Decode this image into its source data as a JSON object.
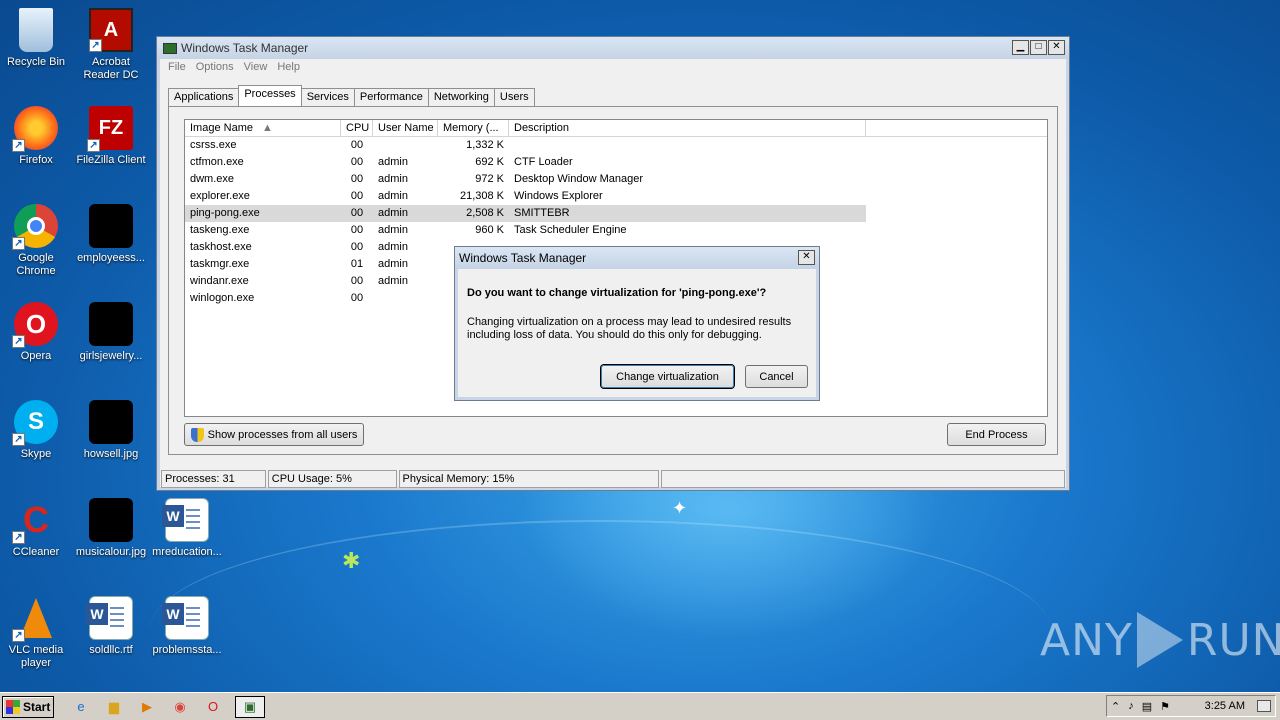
{
  "desktop": {
    "icons": [
      {
        "label": "Recycle Bin"
      },
      {
        "label": "Acrobat Reader DC"
      },
      {
        "label": "Firefox"
      },
      {
        "label": "FileZilla Client"
      },
      {
        "label": "Google Chrome"
      },
      {
        "label": "employeess..."
      },
      {
        "label": "Opera"
      },
      {
        "label": "girlsjewelry..."
      },
      {
        "label": "Skype"
      },
      {
        "label": "howsell.jpg"
      },
      {
        "label": "CCleaner"
      },
      {
        "label": "musicalour.jpg"
      },
      {
        "label": "mreducation..."
      },
      {
        "label": "VLC media player"
      },
      {
        "label": "soldllc.rtf"
      },
      {
        "label": "problemssta..."
      }
    ]
  },
  "task_manager": {
    "title": "Windows Task Manager",
    "menu": [
      "File",
      "Options",
      "View",
      "Help"
    ],
    "tabs": [
      "Applications",
      "Processes",
      "Services",
      "Performance",
      "Networking",
      "Users"
    ],
    "active_tab": "Processes",
    "columns": [
      "Image Name",
      "CPU",
      "User Name",
      "Memory (...",
      "Description"
    ],
    "processes": [
      {
        "name": "csrss.exe",
        "cpu": "00",
        "user": "",
        "memory": "1,332 K",
        "description": ""
      },
      {
        "name": "ctfmon.exe",
        "cpu": "00",
        "user": "admin",
        "memory": "692 K",
        "description": "CTF Loader"
      },
      {
        "name": "dwm.exe",
        "cpu": "00",
        "user": "admin",
        "memory": "972 K",
        "description": "Desktop Window Manager"
      },
      {
        "name": "explorer.exe",
        "cpu": "00",
        "user": "admin",
        "memory": "21,308 K",
        "description": "Windows Explorer"
      },
      {
        "name": "ping-pong.exe",
        "cpu": "00",
        "user": "admin",
        "memory": "2,508 K",
        "description": "SMITTEBR"
      },
      {
        "name": "taskeng.exe",
        "cpu": "00",
        "user": "admin",
        "memory": "960 K",
        "description": "Task Scheduler Engine"
      },
      {
        "name": "taskhost.exe",
        "cpu": "00",
        "user": "admin",
        "memory": "",
        "description": ""
      },
      {
        "name": "taskmgr.exe",
        "cpu": "01",
        "user": "admin",
        "memory": "",
        "description": ""
      },
      {
        "name": "windanr.exe",
        "cpu": "00",
        "user": "admin",
        "memory": "",
        "description": ""
      },
      {
        "name": "winlogon.exe",
        "cpu": "00",
        "user": "",
        "memory": "",
        "description": ""
      }
    ],
    "selected_process": "ping-pong.exe",
    "show_all_label": "Show processes from all users",
    "end_process_label": "End Process",
    "status": {
      "processes": "Processes: 31",
      "cpu": "CPU Usage: 5%",
      "memory": "Physical Memory: 15%"
    }
  },
  "dialog": {
    "title": "Windows Task Manager",
    "question": "Do you want to change virtualization for 'ping-pong.exe'?",
    "message": "Changing virtualization on a process may lead to undesired results including loss of data. You should do this only for debugging.",
    "confirm_label": "Change virtualization",
    "cancel_label": "Cancel"
  },
  "taskbar": {
    "start_label": "Start",
    "clock": "3:25 AM"
  },
  "watermark": {
    "left": "ANY",
    "right": "RUN"
  },
  "colors": {
    "selection": "#d9d9d9",
    "title_bar": "#c4d3e5",
    "desktop": "#1a78cc"
  }
}
